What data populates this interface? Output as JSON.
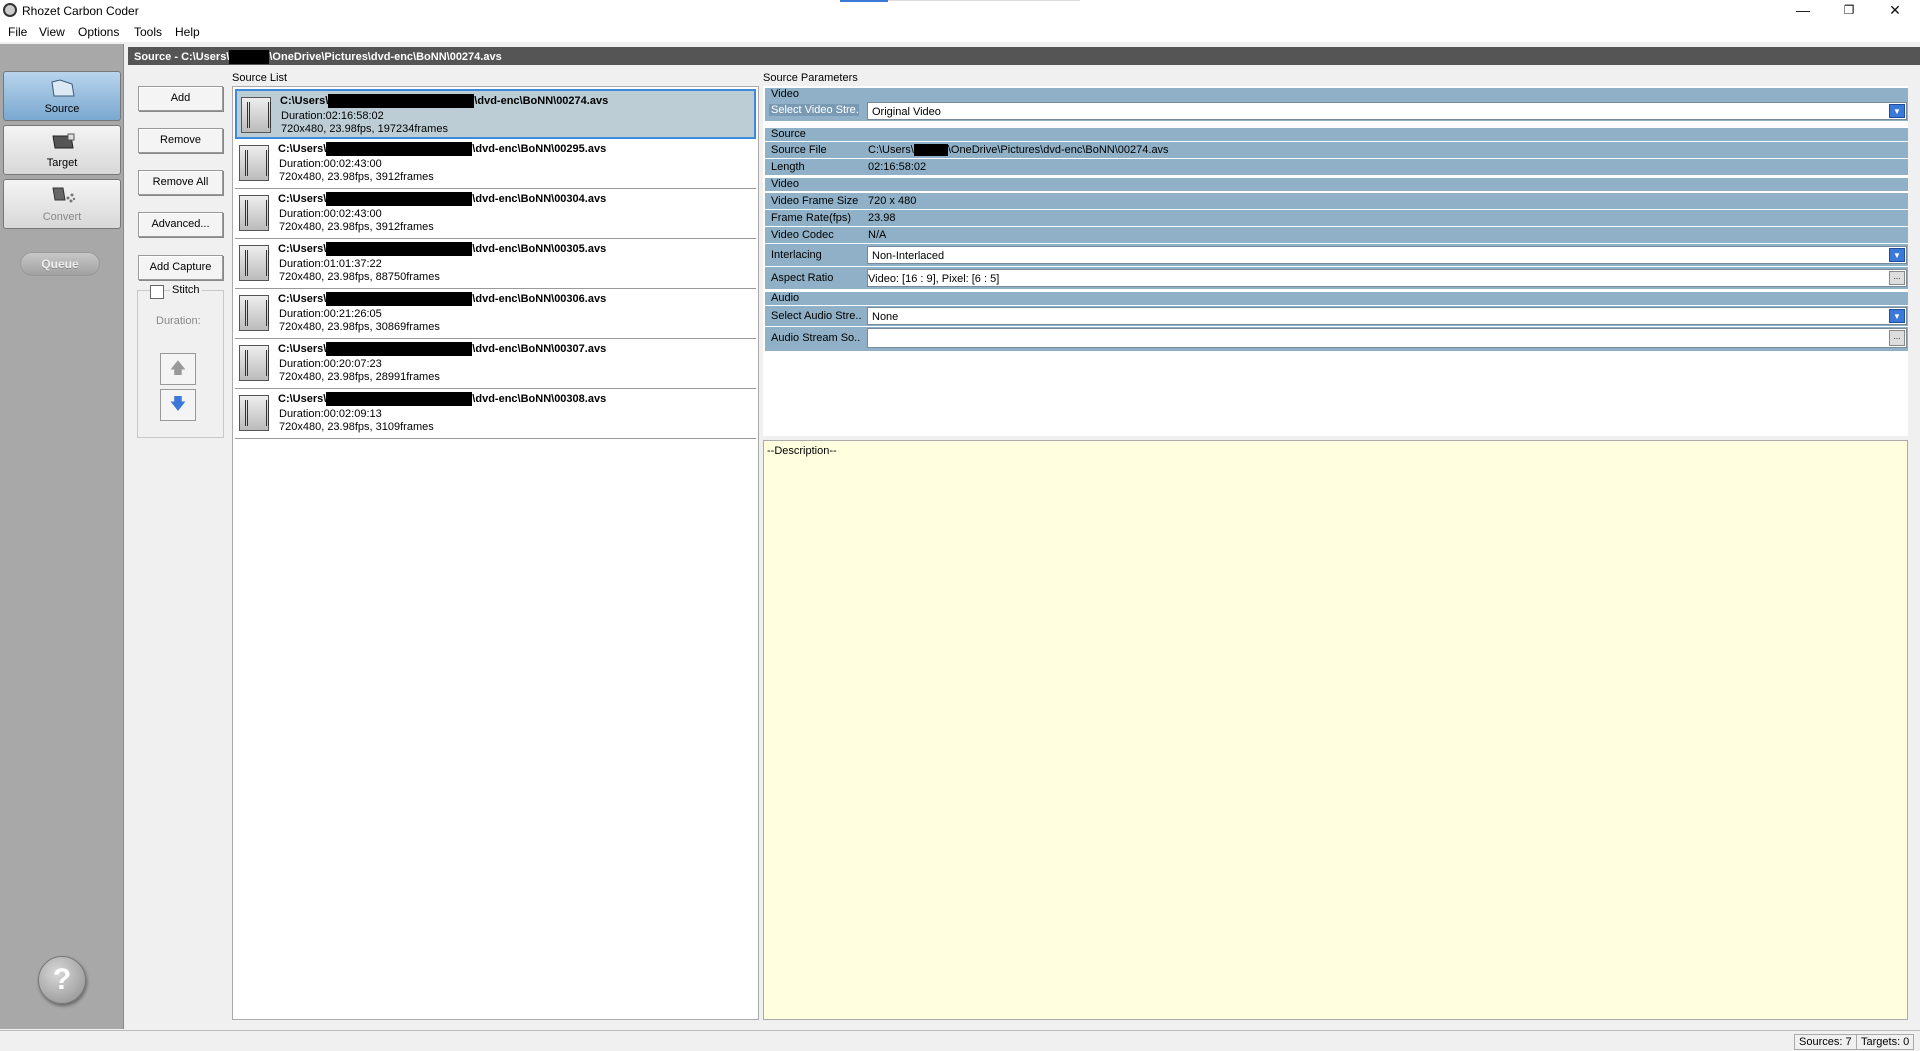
{
  "window": {
    "title": "Rhozet Carbon Coder",
    "minimize": "—",
    "restore": "❐",
    "close": "✕"
  },
  "menu": {
    "items": [
      "File",
      "View",
      "Options",
      "Tools",
      "Help"
    ]
  },
  "nav": {
    "source": "Source",
    "target": "Target",
    "convert": "Convert",
    "queue": "Queue",
    "help_glyph": "?"
  },
  "header": {
    "path_prefix": "Source - C:\\Users\\",
    "path_suffix": "\\OneDrive\\Pictures\\dvd-enc\\BoNN\\00274.avs"
  },
  "actions": {
    "add": "Add",
    "remove": "Remove",
    "remove_all": "Remove All",
    "advanced": "Advanced...",
    "add_capture": "Add Capture",
    "stitch": "Stitch",
    "duration": "Duration:",
    "up_arrow": "🡅",
    "down_arrow": "🡇"
  },
  "source_list": {
    "label": "Source List",
    "items": [
      {
        "path_prefix": "C:\\Users\\",
        "path_suffix": "\\dvd-enc\\BoNN\\00274.avs",
        "duration": "Duration:02:16:58:02",
        "info": "720x480, 23.98fps, 197234frames"
      },
      {
        "path_prefix": "C:\\Users\\",
        "path_suffix": "\\dvd-enc\\BoNN\\00295.avs",
        "duration": "Duration:00:02:43:00",
        "info": "720x480, 23.98fps, 3912frames"
      },
      {
        "path_prefix": "C:\\Users\\",
        "path_suffix": "\\dvd-enc\\BoNN\\00304.avs",
        "duration": "Duration:00:02:43:00",
        "info": "720x480, 23.98fps, 3912frames"
      },
      {
        "path_prefix": "C:\\Users\\",
        "path_suffix": "\\dvd-enc\\BoNN\\00305.avs",
        "duration": "Duration:01:01:37:22",
        "info": "720x480, 23.98fps, 88750frames"
      },
      {
        "path_prefix": "C:\\Users\\",
        "path_suffix": "\\dvd-enc\\BoNN\\00306.avs",
        "duration": "Duration:00:21:26:05",
        "info": "720x480, 23.98fps, 30869frames"
      },
      {
        "path_prefix": "C:\\Users\\",
        "path_suffix": "\\dvd-enc\\BoNN\\00307.avs",
        "duration": "Duration:00:20:07:23",
        "info": "720x480, 23.98fps, 28991frames"
      },
      {
        "path_prefix": "C:\\Users\\",
        "path_suffix": "\\dvd-enc\\BoNN\\00308.avs",
        "duration": "Duration:00:02:09:13",
        "info": "720x480, 23.98fps, 3109frames"
      }
    ]
  },
  "params": {
    "label": "Source Parameters",
    "sec_video": "Video",
    "select_video_stream_key": "Select Video Stre...",
    "select_video_stream_val": "Original Video",
    "sec_source": "Source",
    "source_file_key": "Source File",
    "source_file_prefix": "C:\\Users\\",
    "source_file_suffix": "\\OneDrive\\Pictures\\dvd-enc\\BoNN\\00274.avs",
    "length_key": "Length",
    "length_val": "02:16:58:02",
    "sec_video2": "Video",
    "frame_size_key": "Video Frame Size",
    "frame_size_val": "720 x 480",
    "frame_rate_key": "Frame Rate(fps)",
    "frame_rate_val": "23.98",
    "codec_key": "Video Codec",
    "codec_val": "N/A",
    "interlacing_key": "Interlacing",
    "interlacing_val": "Non-Interlaced",
    "aspect_key": "Aspect Ratio",
    "aspect_val": "Video: [16 : 9], Pixel: [6 : 5]",
    "sec_audio": "Audio",
    "select_audio_stream_key": "Select Audio Stre...",
    "select_audio_stream_val": "None",
    "audio_stream_source_key": "Audio Stream So...",
    "audio_stream_source_val": "",
    "ellipsis": "..."
  },
  "description": {
    "text": "--Description--"
  },
  "status": {
    "sources": "Sources: 7",
    "targets": "Targets: 0"
  },
  "colors": {
    "selected_row": "#bccdd6",
    "section_header": "#90b0c8",
    "description_bg": "#ffffe0",
    "path_header_bg": "#555555"
  }
}
